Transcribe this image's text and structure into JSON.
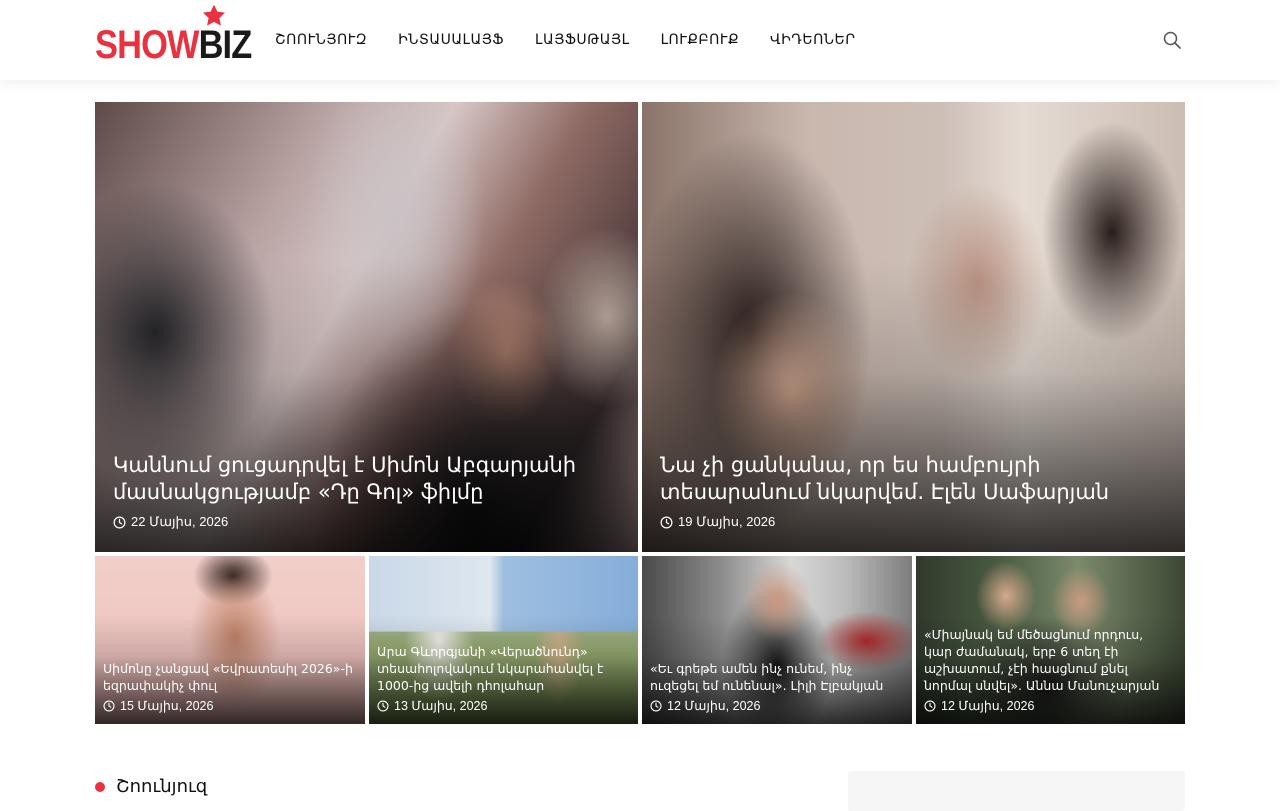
{
  "brand": {
    "logo_show": "SHOW",
    "logo_biz": "BIZ",
    "logo_red": "#e8323f"
  },
  "nav": [
    {
      "label": "ՇՈՈՒՆՅՈՒԶ"
    },
    {
      "label": "ԻՆՏԱՍԱԼԱՅՖ"
    },
    {
      "label": "ԼԱՅՖՍԹԱՅԼ"
    },
    {
      "label": "ԼՈՒՔԲՈՒՔ"
    },
    {
      "label": "ՎԻԴԵՈՆԵՐ"
    }
  ],
  "featured": [
    {
      "title": "Կաննում ցուցադրվել է Սիմոն Աբգարյանի մասնակցությամբ «Դը Գոլ» ֆիլմը",
      "date": "22 Մայիս, 2026"
    },
    {
      "title": "Նա չի ցանկանա, որ ես համբույրի տեսարանում նկարվեմ. Էլեն Սաֆարյան",
      "date": "19 Մայիս, 2026"
    }
  ],
  "cards": [
    {
      "title": "Սիմոնը չանցավ «Եվրատեսիլ 2026»-ի եզրափակիչ փուլ",
      "date": "15 Մայիս, 2026"
    },
    {
      "title": "Արա Գևորգյանի «Վերածնունդ» տեսահոլովակում նկարահանվել է 1000-ից ավելի դհոլահար",
      "date": "13 Մայիս, 2026"
    },
    {
      "title": "«Եւ գրեթե ամեն ինչ ունեմ, ինչ ուզեցել եմ ունենալ». Լիլի Էլբակյան",
      "date": "12 Մայիս, 2026"
    },
    {
      "title": "«Միայնակ եմ մեծացնում որդուս, կար ժամանակ, երբ 6 տեղ էի աշխատում, չէի հասցնում քնել նորմալ սնվել». Աննա Մանուչարյան",
      "date": "12 Մայիս, 2026"
    }
  ],
  "section": {
    "title": "Շոունյուզ"
  }
}
